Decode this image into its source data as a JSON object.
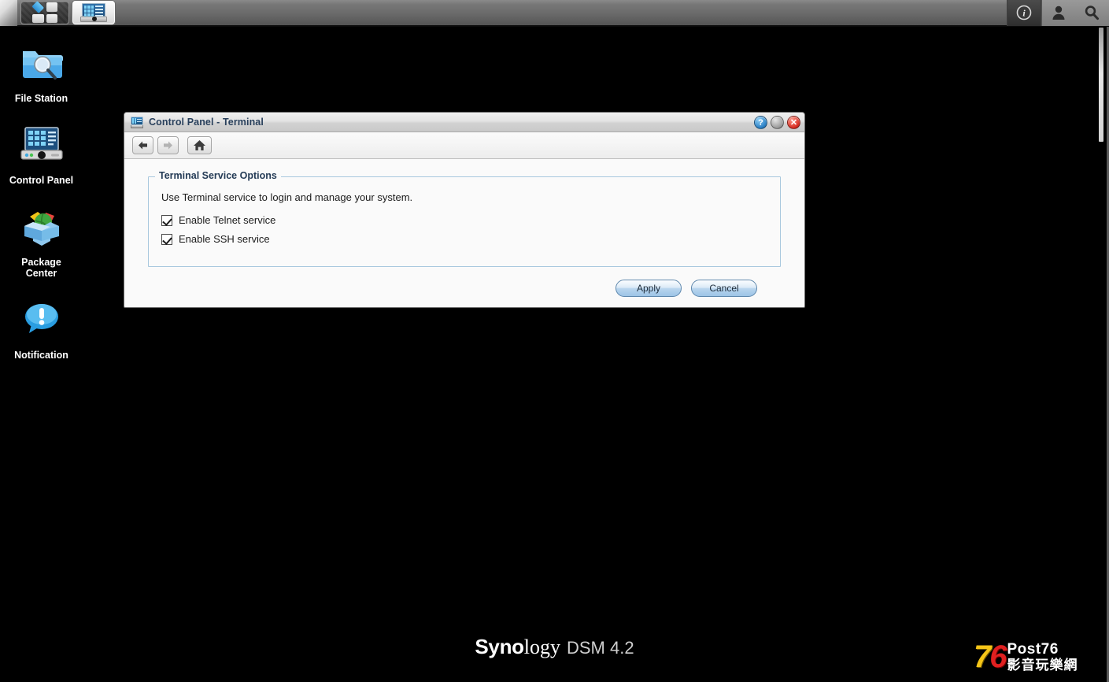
{
  "taskbar": {
    "main_menu_label": "Main Menu",
    "main_menu_icon": "grid-squares-icon",
    "control_panel_task_label": "Control Panel",
    "control_panel_task_icon": "control-panel-icon",
    "info_icon": "info-circle-icon",
    "user_icon": "user-person-icon",
    "search_icon": "search-magnifier-icon"
  },
  "desktop": {
    "icons": [
      {
        "label": "File Station",
        "icon": "folder-magnifier-icon"
      },
      {
        "label": "Control Panel",
        "icon": "control-panel-icon"
      },
      {
        "label": "Package\nCenter",
        "label_line1": "Package",
        "label_line2": "Center",
        "icon": "package-box-globe-icon"
      },
      {
        "label": "Notification",
        "icon": "speech-bubble-exclamation-icon"
      }
    ]
  },
  "window": {
    "title": "Control Panel - Terminal",
    "title_icon": "control-panel-icon",
    "controls": {
      "help_label": "?",
      "help_name": "help-button",
      "minimize_label": "",
      "close_label": "✕"
    },
    "toolbar": {
      "back_label": "←",
      "forward_label": "→",
      "home_label": "⌂"
    },
    "fieldset": {
      "legend": "Terminal Service Options",
      "description": "Use Terminal service to login and manage your system.",
      "checkboxes": [
        {
          "label": "Enable Telnet service",
          "checked": true
        },
        {
          "label": "Enable SSH service",
          "checked": true
        }
      ]
    },
    "buttons": {
      "apply": "Apply",
      "cancel": "Cancel"
    }
  },
  "footer": {
    "brand_bold": "Syno",
    "brand_light": "logy",
    "product": "DSM 4.2"
  },
  "watermark": {
    "seven": "7",
    "six": "6",
    "post": "Post76",
    "chinese": "影音玩樂網"
  },
  "colors": {
    "desktop_bg": "#000000",
    "taskbar_top": "#8a8a8a",
    "taskbar_bottom": "#545454",
    "window_bg": "#fafafa",
    "title_text": "#29405c",
    "fieldset_border": "#a8c8de",
    "button_blue": "#9dc4e6",
    "accent_red": "#d62b1f",
    "accent_blue": "#2a7fc4"
  }
}
